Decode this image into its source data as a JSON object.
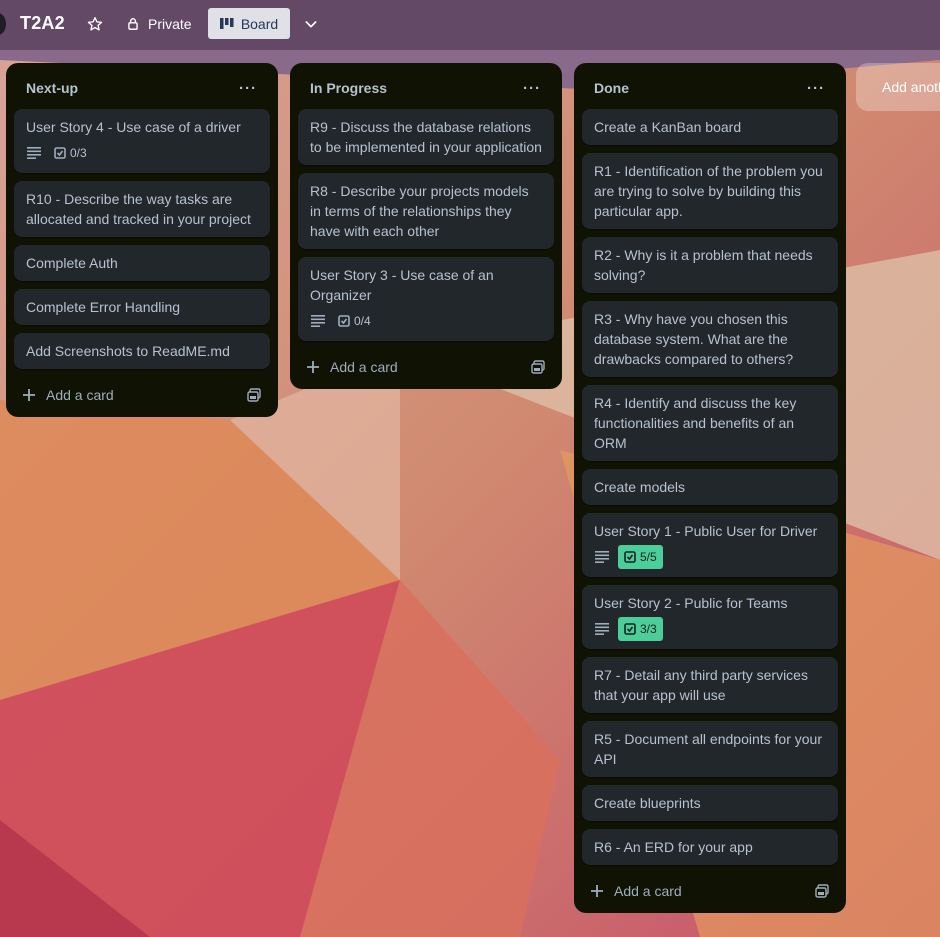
{
  "board": {
    "title": "T2A2",
    "visibility_label": "Private",
    "view_label": "Board"
  },
  "lists": [
    {
      "title": "Next-up",
      "cards": [
        {
          "title": "User Story 4 - Use case of a driver",
          "has_description": true,
          "checklist": "0/3",
          "checklist_complete": false
        },
        {
          "title": "R10 - Describe the way tasks are allocated and tracked in your project"
        },
        {
          "title": "Complete Auth"
        },
        {
          "title": "Complete Error Handling"
        },
        {
          "title": "Add Screenshots to ReadME.md"
        }
      ],
      "add_card_label": "Add a card"
    },
    {
      "title": "In Progress",
      "cards": [
        {
          "title": "R9 - Discuss the database relations to be implemented in your application"
        },
        {
          "title": "R8 - Describe your projects models in terms of the relationships they have with each other"
        },
        {
          "title": "User Story 3 - Use case of an Organizer",
          "has_description": true,
          "checklist": "0/4",
          "checklist_complete": false
        }
      ],
      "add_card_label": "Add a card"
    },
    {
      "title": "Done",
      "cards": [
        {
          "title": "Create a KanBan board"
        },
        {
          "title": "R1 - Identification of the problem you are trying to solve by building this particular app."
        },
        {
          "title": "R2 - Why is it a problem that needs solving?"
        },
        {
          "title": "R3 - Why have you chosen this database system. What are the drawbacks compared to others?"
        },
        {
          "title": "R4 - Identify and discuss the key functionalities and benefits of an ORM"
        },
        {
          "title": "Create models"
        },
        {
          "title": "User Story 1 - Public User for Driver",
          "has_description": true,
          "checklist": "5/5",
          "checklist_complete": true
        },
        {
          "title": "User Story 2 - Public for Teams",
          "has_description": true,
          "checklist": "3/3",
          "checklist_complete": true
        },
        {
          "title": "R7 - Detail any third party services that your app will use"
        },
        {
          "title": "R5 - Document all endpoints for your API"
        },
        {
          "title": "Create blueprints"
        },
        {
          "title": "R6 - An ERD for your app"
        }
      ],
      "add_card_label": "Add a card"
    }
  ],
  "add_list_label": "Add another list",
  "icons": {
    "star": "star-icon",
    "lock": "lock-icon",
    "board": "board-icon",
    "chevron": "chevron-down-icon",
    "more": "more-icon",
    "plus": "plus-icon",
    "template": "template-icon",
    "description": "description-icon",
    "checklist": "checklist-icon"
  },
  "colors": {
    "list_bg": "#101204",
    "card_bg": "#22272b",
    "card_text": "#b6c2cf",
    "checklist_complete": "#4bce97"
  }
}
